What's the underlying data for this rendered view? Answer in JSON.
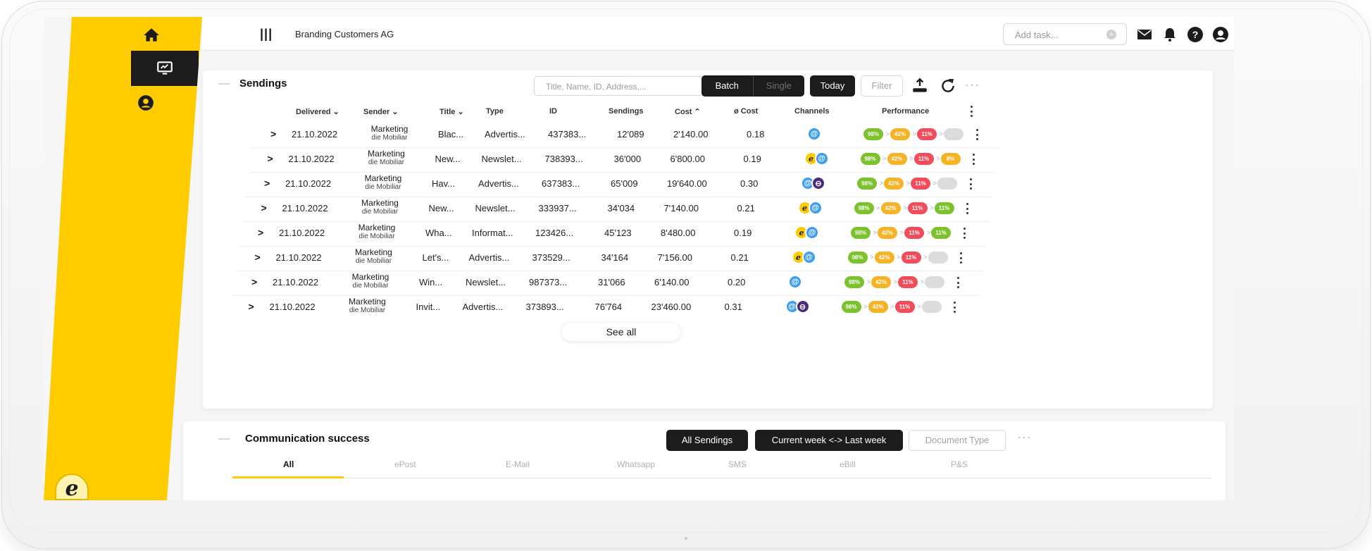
{
  "colors": {
    "brand_yellow": "#ffcc00",
    "dark": "#1c1c1c",
    "green": "#7cc22c",
    "orange": "#f5b325",
    "red": "#f24b5a",
    "gray": "#dcdcdc",
    "email_blue": "#3b9cf0",
    "whatsapp_purple": "#4a2b7a"
  },
  "sidebar": {
    "items": [
      {
        "icon": "home-icon",
        "active": false
      },
      {
        "icon": "monitor-icon",
        "active": true
      },
      {
        "icon": "user-circle-icon",
        "active": false
      }
    ],
    "logo": "e"
  },
  "topbar": {
    "menu_icon": "|||",
    "company": "Branding Customers AG",
    "add_task_placeholder": "Add task...",
    "add_task_plus": "+",
    "icons": [
      "mail-icon",
      "bell-icon",
      "help-icon",
      "profile-icon"
    ]
  },
  "sendings": {
    "title": "Sendings",
    "search_placeholder": "Title, Name, ID, Address,...",
    "batch_label": "Batch",
    "single_label": "Single",
    "today_label": "Today",
    "filter_label": "Filter",
    "more_label": "···",
    "columns": {
      "delivered": "Delivered",
      "sender": "Sender",
      "title": "Title",
      "type": "Type",
      "id": "ID",
      "sendings": "Sendings",
      "cost": "Cost",
      "avg_cost": "ø Cost",
      "channels": "Channels",
      "performance": "Performance"
    },
    "rows": [
      {
        "date": "21.10.2022",
        "sender1": "Marketing",
        "sender2": "die Mobiliar",
        "title": "Blac...",
        "type": "Advertis...",
        "id": "437383...",
        "sendings": "12'089",
        "cost": "2'140.00",
        "avg": "0.18",
        "channels": [
          "email"
        ],
        "perf": [
          {
            "v": "98%",
            "c": "green"
          },
          {
            "v": "42%",
            "c": "orange"
          },
          {
            "v": "11%",
            "c": "red"
          },
          {
            "v": "",
            "c": "gray"
          }
        ]
      },
      {
        "date": "21.10.2022",
        "sender1": "Marketing",
        "sender2": "die Mobiliar",
        "title": "New...",
        "type": "Newslet...",
        "id": "738393...",
        "sendings": "36'000",
        "cost": "6'800.00",
        "avg": "0.19",
        "channels": [
          "epost",
          "email"
        ],
        "perf": [
          {
            "v": "98%",
            "c": "green"
          },
          {
            "v": "42%",
            "c": "orange"
          },
          {
            "v": "11%",
            "c": "red"
          },
          {
            "v": "8%",
            "c": "orange"
          }
        ]
      },
      {
        "date": "21.10.2022",
        "sender1": "Marketing",
        "sender2": "die Mobiliar",
        "title": "Hav...",
        "type": "Advertis...",
        "id": "637383...",
        "sendings": "65'009",
        "cost": "19'640.00",
        "avg": "0.30",
        "channels": [
          "email",
          "whatsapp"
        ],
        "perf": [
          {
            "v": "98%",
            "c": "green"
          },
          {
            "v": "42%",
            "c": "orange"
          },
          {
            "v": "11%",
            "c": "red"
          },
          {
            "v": "",
            "c": "gray"
          }
        ]
      },
      {
        "date": "21.10.2022",
        "sender1": "Marketing",
        "sender2": "die Mobiliar",
        "title": "New...",
        "type": "Newslet...",
        "id": "333937...",
        "sendings": "34'034",
        "cost": "7'140.00",
        "avg": "0.21",
        "channels": [
          "epost",
          "email"
        ],
        "perf": [
          {
            "v": "98%",
            "c": "green"
          },
          {
            "v": "42%",
            "c": "orange"
          },
          {
            "v": "11%",
            "c": "red"
          },
          {
            "v": "11%",
            "c": "green"
          }
        ]
      },
      {
        "date": "21.10.2022",
        "sender1": "Marketing",
        "sender2": "die Mobiliar",
        "title": "Wha...",
        "type": "Informat...",
        "id": "123426...",
        "sendings": "45'123",
        "cost": "8'480.00",
        "avg": "0.19",
        "channels": [
          "epost",
          "email"
        ],
        "perf": [
          {
            "v": "98%",
            "c": "green"
          },
          {
            "v": "42%",
            "c": "orange"
          },
          {
            "v": "11%",
            "c": "red"
          },
          {
            "v": "11%",
            "c": "green"
          }
        ]
      },
      {
        "date": "21.10.2022",
        "sender1": "Marketing",
        "sender2": "die Mobiliar",
        "title": "Let's...",
        "type": "Advertis...",
        "id": "373529...",
        "sendings": "34'164",
        "cost": "7'156.00",
        "avg": "0.21",
        "channels": [
          "epost",
          "email"
        ],
        "perf": [
          {
            "v": "98%",
            "c": "green"
          },
          {
            "v": "42%",
            "c": "orange"
          },
          {
            "v": "11%",
            "c": "red"
          },
          {
            "v": "",
            "c": "gray"
          }
        ]
      },
      {
        "date": "21.10.2022",
        "sender1": "Marketing",
        "sender2": "die Mobiliar",
        "title": "Win...",
        "type": "Newslet...",
        "id": "987373...",
        "sendings": "31'066",
        "cost": "6'140.00",
        "avg": "0.20",
        "channels": [
          "email"
        ],
        "perf": [
          {
            "v": "98%",
            "c": "green"
          },
          {
            "v": "42%",
            "c": "orange"
          },
          {
            "v": "11%",
            "c": "red"
          },
          {
            "v": "",
            "c": "gray"
          }
        ]
      },
      {
        "date": "21.10.2022",
        "sender1": "Marketing",
        "sender2": "die Mobiliar",
        "title": "Invit...",
        "type": "Advertis...",
        "id": "373893...",
        "sendings": "76'764",
        "cost": "23'460.00",
        "avg": "0.31",
        "channels": [
          "email",
          "whatsapp"
        ],
        "perf": [
          {
            "v": "98%",
            "c": "green"
          },
          {
            "v": "42%",
            "c": "orange"
          },
          {
            "v": "11%",
            "c": "red"
          },
          {
            "v": "",
            "c": "gray"
          }
        ]
      }
    ],
    "see_all": "See all"
  },
  "communication": {
    "title": "Communication success",
    "all_sendings_label": "All Sendings",
    "week_label": "Current week <-> Last week",
    "doc_type_label": "Document Type",
    "more_label": "···",
    "tabs": [
      "All",
      "ePost",
      "E-Mail",
      "Whatsapp",
      "SMS",
      "eBill",
      "P&S"
    ],
    "active_tab": "All"
  }
}
